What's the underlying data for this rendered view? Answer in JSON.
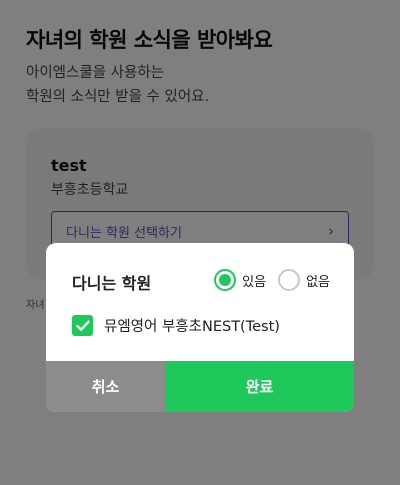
{
  "page": {
    "title": "자녀의 학원 소식을 받아봐요",
    "subtitle_line1": "아이엠스쿨을 사용하는",
    "subtitle_line2": "학원의 소식만 받을 수 있어요."
  },
  "card": {
    "child_name": "test",
    "school_name": "부흥초등학교",
    "select_label": "다니는 학원 선택하기",
    "chevron": "›"
  },
  "footnote": "자녀",
  "dialog": {
    "title": "다니는 학원",
    "radio_yes": "있음",
    "radio_no": "없음",
    "selected": "있음",
    "academy_item": "뮤엠영어 부흥초NEST(Test)",
    "academy_checked": true,
    "cancel_label": "취소",
    "confirm_label": "완료"
  },
  "colors": {
    "accent_green": "#1ec85a",
    "accent_purple": "#5b4fc4",
    "cancel_gray": "#8c8c8c"
  }
}
